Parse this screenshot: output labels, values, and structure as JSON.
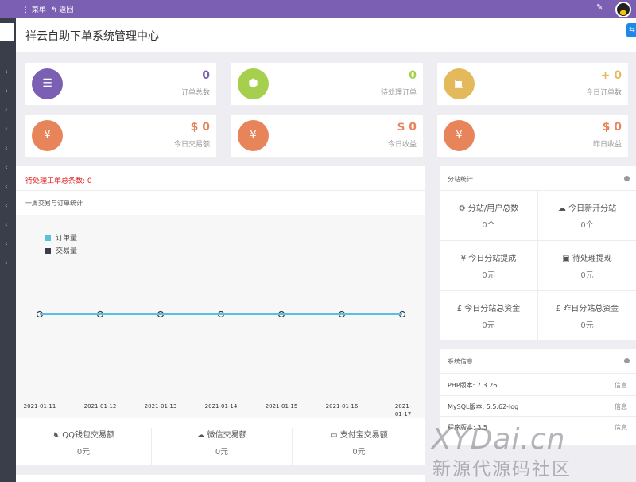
{
  "topbar": {
    "menu_label": "菜单",
    "back_label": "返回"
  },
  "header": {
    "title": "祥云自助下单系统管理中心"
  },
  "stats": [
    {
      "value": "0",
      "label": "订单总数",
      "color": "#7b5fb2",
      "value_color": "#7b5fb2",
      "icon": "list-icon",
      "glyph": "☰"
    },
    {
      "value": "0",
      "label": "待处理订单",
      "color": "#a6cf4e",
      "value_color": "#a6cf4e",
      "icon": "cube-icon",
      "glyph": "⬢"
    },
    {
      "value": "+ 0",
      "label": "今日订单数",
      "color": "#e4b95b",
      "value_color": "#e4b95b",
      "icon": "briefcase-icon",
      "glyph": "▣"
    },
    {
      "value": "$ 0",
      "label": "今日交易额",
      "color": "#e8845a",
      "value_color": "#e8845a",
      "icon": "yen-icon",
      "glyph": "¥"
    },
    {
      "value": "$ 0",
      "label": "今日收益",
      "color": "#e8845a",
      "value_color": "#e8845a",
      "icon": "yen-icon",
      "glyph": "¥"
    },
    {
      "value": "$ 0",
      "label": "昨日收益",
      "color": "#e8845a",
      "value_color": "#e8845a",
      "icon": "yen-icon",
      "glyph": "¥"
    }
  ],
  "main": {
    "pending_text": "待处理工单总条数:  0",
    "chart_title": "一周交易与订单统计",
    "legend": [
      {
        "name": "订单量",
        "color": "#5bc0de"
      },
      {
        "name": "交易量",
        "color": "#3a3d4a"
      }
    ],
    "payments": [
      {
        "icon": "qq-icon",
        "glyph": "♞",
        "label": "QQ钱包交易额",
        "value": "0元"
      },
      {
        "icon": "wechat-icon",
        "glyph": "☁",
        "label": "微信交易额",
        "value": "0元"
      },
      {
        "icon": "credit-card-icon",
        "glyph": "▭",
        "label": "支付宝交易额",
        "value": "0元"
      }
    ]
  },
  "chart_data": {
    "type": "line",
    "x": [
      "2021-01-11",
      "2021-01-12",
      "2021-01-13",
      "2021-01-14",
      "2021-01-15",
      "2021-01-16",
      "2021-01-17"
    ],
    "series": [
      {
        "name": "订单量",
        "values": [
          0,
          0,
          0,
          0,
          0,
          0,
          0
        ]
      },
      {
        "name": "交易量",
        "values": [
          0,
          0,
          0,
          0,
          0,
          0,
          0
        ]
      }
    ],
    "grid": false,
    "legend_position": "top-left"
  },
  "substation": {
    "title": "分站统计",
    "cells": [
      {
        "icon": "sitemap-icon",
        "glyph": "⚙",
        "label": "分站/用户总数",
        "value": "0个"
      },
      {
        "icon": "cloud-icon",
        "glyph": "☁",
        "label": "今日新开分站",
        "value": "0个"
      },
      {
        "icon": "yen-icon",
        "glyph": "¥",
        "label": "今日分站提成",
        "value": "0元"
      },
      {
        "icon": "money-icon",
        "glyph": "▣",
        "label": "待处理提现",
        "value": "0元"
      },
      {
        "icon": "pound-icon",
        "glyph": "£",
        "label": "今日分站总资金",
        "value": "0元"
      },
      {
        "icon": "pound-icon",
        "glyph": "£",
        "label": "昨日分站总资金",
        "value": "0元"
      }
    ]
  },
  "system": {
    "title": "系统信息",
    "rows": [
      {
        "label": "PHP版本:  7.3.26",
        "info": "信息"
      },
      {
        "label": "MySQL版本:  5.5.62-log",
        "info": "信息"
      },
      {
        "label": "程序版本:  3.5",
        "info": "信息"
      }
    ]
  },
  "watermark": {
    "line1": "XYDai.cn",
    "line2": "新源代源码社区"
  }
}
